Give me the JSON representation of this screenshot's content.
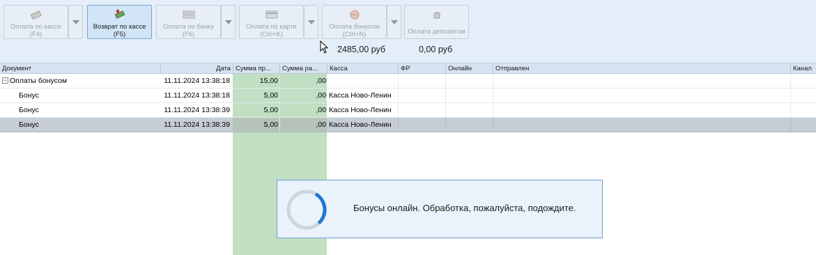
{
  "toolbar": {
    "buttons": [
      {
        "label": "Оплата по кассе",
        "hotkey": "(F4)",
        "icon": "cash-icon",
        "enabled": false
      },
      {
        "label": "Возврат по кассе",
        "hotkey": "(F5)",
        "icon": "cash-return-icon",
        "enabled": true
      },
      {
        "label": "Оплата по банку",
        "hotkey": "(F6)",
        "icon": "bank-icon",
        "enabled": false
      },
      {
        "label": "Оплата по карте",
        "hotkey": "(Ctrl+K)",
        "icon": "card-icon",
        "enabled": false
      },
      {
        "label": "Оплата бонусом",
        "hotkey": "(Ctrl+N)",
        "icon": "bonus-icon",
        "enabled": false
      },
      {
        "label": "Оплата депозитом",
        "hotkey": "",
        "icon": "deposit-icon",
        "enabled": false
      }
    ],
    "totals": {
      "bonus_amount": "2485,00 руб",
      "deposit_amount": "0,00 руб"
    }
  },
  "grid": {
    "columns": [
      "Документ",
      "Дата",
      "Сумма пр...",
      "Сумма ра...",
      "Касса",
      "ФР",
      "Онлайн",
      "Отправлен",
      "Канал"
    ],
    "group": {
      "name": "Оплаты бонусом",
      "date": "11.11.2024 13:38:18",
      "sum_in": "15,00",
      "sum_out": ",00",
      "expander": "−"
    },
    "rows": [
      {
        "doc": "Бонус",
        "date": "11.11.2024 13:38:18",
        "sum_in": "5,00",
        "sum_out": ",00",
        "kassa": "Касса Ново-Ленин",
        "selected": false
      },
      {
        "doc": "Бонус",
        "date": "11.11.2024 13:38:39",
        "sum_in": "5,00",
        "sum_out": ",00",
        "kassa": "Касса Ново-Ленин",
        "selected": false
      },
      {
        "doc": "Бонус",
        "date": "11.11.2024 13:38:39",
        "sum_in": "5,00",
        "sum_out": ",00",
        "kassa": "Касса Ново-Ленин",
        "selected": true
      }
    ]
  },
  "dialog": {
    "message": "Бонусы онлайн. Обработка, пожалуйста, подождите.",
    "progress": 0.3
  },
  "colors": {
    "accent": "#1f78d1",
    "sum_column": "#c1dfc2",
    "toolbar_bg": "#e4eef9",
    "selected_row": "#c7cdd6"
  }
}
